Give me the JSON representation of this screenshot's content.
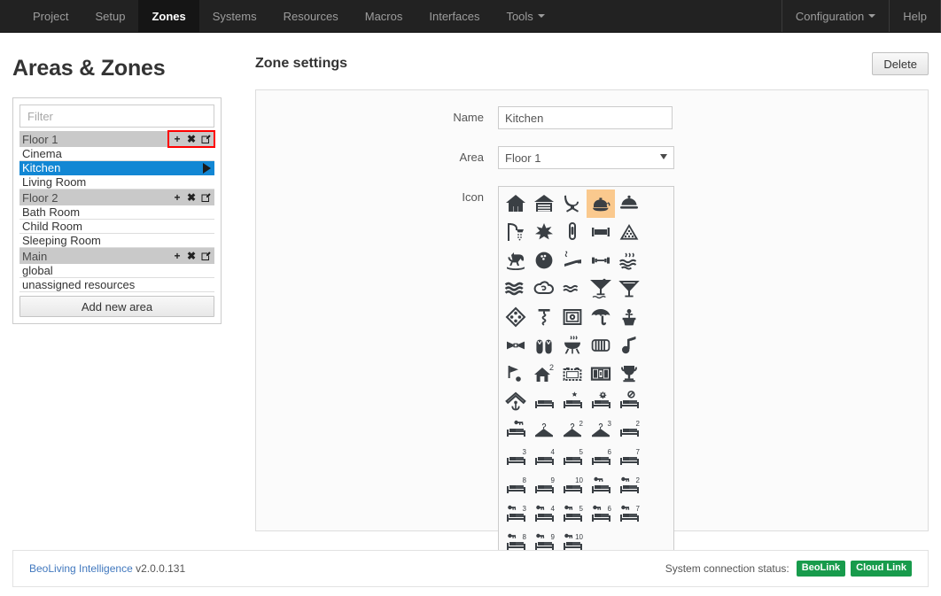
{
  "nav": {
    "left_items": [
      {
        "label": "Project",
        "active": false,
        "caret": false
      },
      {
        "label": "Setup",
        "active": false,
        "caret": false
      },
      {
        "label": "Zones",
        "active": true,
        "caret": false
      },
      {
        "label": "Systems",
        "active": false,
        "caret": false
      },
      {
        "label": "Resources",
        "active": false,
        "caret": false
      },
      {
        "label": "Macros",
        "active": false,
        "caret": false
      },
      {
        "label": "Interfaces",
        "active": false,
        "caret": false
      },
      {
        "label": "Tools",
        "active": false,
        "caret": true
      }
    ],
    "right_items": [
      {
        "label": "Configuration",
        "active": false,
        "caret": true
      },
      {
        "label": "Help",
        "active": false,
        "caret": false
      }
    ]
  },
  "sidebar": {
    "title": "Areas & Zones",
    "filter": {
      "value": "",
      "placeholder": "Filter"
    },
    "action_icons": {
      "add": "+",
      "remove": "✖",
      "edit": "edit-icon"
    },
    "groups": [
      {
        "label": "Floor 1",
        "actions_highlighted": true,
        "zones": [
          {
            "label": "Cinema",
            "selected": false
          },
          {
            "label": "Kitchen",
            "selected": true
          },
          {
            "label": "Living Room",
            "selected": false
          }
        ]
      },
      {
        "label": "Floor 2",
        "actions_highlighted": false,
        "zones": [
          {
            "label": "Bath Room",
            "selected": false
          },
          {
            "label": "Child Room",
            "selected": false
          },
          {
            "label": "Sleeping Room",
            "selected": false
          }
        ]
      },
      {
        "label": "Main",
        "actions_highlighted": false,
        "zones": [
          {
            "label": "global",
            "selected": false
          },
          {
            "label": "unassigned resources",
            "selected": false
          }
        ]
      }
    ],
    "add_area_label": "Add new area"
  },
  "main": {
    "section_title": "Zone settings",
    "delete_label": "Delete",
    "fields": {
      "name_label": "Name",
      "name_value": "Kitchen",
      "name_placeholder": "",
      "area_label": "Area",
      "area_value": "Floor 1",
      "area_options": [
        "Floor 1",
        "Floor 2",
        "Main"
      ],
      "icon_label": "Icon"
    },
    "icons": [
      {
        "name": "house-icon",
        "selected": false
      },
      {
        "name": "garage-icon",
        "selected": false
      },
      {
        "name": "lounge-chair-icon",
        "selected": false
      },
      {
        "name": "teapot-icon",
        "selected": true
      },
      {
        "name": "food-cloche-icon",
        "selected": false
      },
      {
        "name": "shower-icon",
        "selected": false
      },
      {
        "name": "leaf-star-icon",
        "selected": false
      },
      {
        "name": "paperclip-icon",
        "selected": false
      },
      {
        "name": "framed-picture-icon",
        "selected": false
      },
      {
        "name": "billiards-rack-icon",
        "selected": false
      },
      {
        "name": "rocking-horse-icon",
        "selected": false
      },
      {
        "name": "bowling-ball-icon",
        "selected": false
      },
      {
        "name": "cigar-smoke-icon",
        "selected": false
      },
      {
        "name": "dumbbell-icon",
        "selected": false
      },
      {
        "name": "hot-spring-icon",
        "selected": false
      },
      {
        "name": "waves-icon",
        "selected": false
      },
      {
        "name": "steam-cloud-icon",
        "selected": false
      },
      {
        "name": "small-waves-icon",
        "selected": false
      },
      {
        "name": "cocktail-water-icon",
        "selected": false
      },
      {
        "name": "martini-icon",
        "selected": false
      },
      {
        "name": "dice-domino-icon",
        "selected": false
      },
      {
        "name": "corkscrew-icon",
        "selected": false
      },
      {
        "name": "safe-icon",
        "selected": false
      },
      {
        "name": "umbrella-icon",
        "selected": false
      },
      {
        "name": "potted-plant-icon",
        "selected": false
      },
      {
        "name": "bow-tie-icon",
        "selected": false
      },
      {
        "name": "flip-flops-icon",
        "selected": false
      },
      {
        "name": "bbq-grill-icon",
        "selected": false
      },
      {
        "name": "radiator-icon",
        "selected": false
      },
      {
        "name": "music-note-icon",
        "selected": false
      },
      {
        "name": "golf-flag-icon",
        "selected": false
      },
      {
        "name": "house-2-icon",
        "selected": false
      },
      {
        "name": "projector-screen-icon",
        "selected": false
      },
      {
        "name": "luggage-trunk-icon",
        "selected": false
      },
      {
        "name": "trophy-icon",
        "selected": false
      },
      {
        "name": "anchor-house-icon",
        "selected": false
      },
      {
        "name": "bed-icon",
        "selected": false
      },
      {
        "name": "bed-star-icon",
        "selected": false
      },
      {
        "name": "bed-gear-icon",
        "selected": false
      },
      {
        "name": "bed-no-smoking-icon",
        "selected": false
      },
      {
        "name": "bed-key-icon",
        "selected": false
      },
      {
        "name": "hanger-icon",
        "selected": false
      },
      {
        "name": "hanger-2-icon",
        "selected": false,
        "badge": "2"
      },
      {
        "name": "hanger-3-icon",
        "selected": false,
        "badge": "3"
      },
      {
        "name": "bed-2-icon",
        "selected": false,
        "badge": "2"
      },
      {
        "name": "bed-3-icon",
        "selected": false,
        "badge": "3"
      },
      {
        "name": "bed-4-icon",
        "selected": false,
        "badge": "4"
      },
      {
        "name": "bed-5-icon",
        "selected": false,
        "badge": "5"
      },
      {
        "name": "bed-6-icon",
        "selected": false,
        "badge": "6"
      },
      {
        "name": "bed-7-icon",
        "selected": false,
        "badge": "7"
      },
      {
        "name": "bed-8-icon",
        "selected": false,
        "badge": "8"
      },
      {
        "name": "bed-9-icon",
        "selected": false,
        "badge": "9"
      },
      {
        "name": "bed-10-icon",
        "selected": false,
        "badge": "10"
      },
      {
        "name": "bed-key-plain-icon",
        "selected": false
      },
      {
        "name": "bed-key-2-icon",
        "selected": false,
        "badge": "2"
      },
      {
        "name": "bed-key-3-icon",
        "selected": false,
        "badge": "3"
      },
      {
        "name": "bed-key-4-icon",
        "selected": false,
        "badge": "4"
      },
      {
        "name": "bed-key-5-icon",
        "selected": false,
        "badge": "5"
      },
      {
        "name": "bed-key-6-icon",
        "selected": false,
        "badge": "6"
      },
      {
        "name": "bed-key-7-icon",
        "selected": false,
        "badge": "7"
      },
      {
        "name": "bed-key-8-icon",
        "selected": false,
        "badge": "8"
      },
      {
        "name": "bed-key-9-icon",
        "selected": false,
        "badge": "9"
      },
      {
        "name": "bed-key-10-icon",
        "selected": false,
        "badge": "10"
      }
    ]
  },
  "footer": {
    "app_name": "BeoLiving Intelligence",
    "version": "v2.0.0.131",
    "status_label": "System connection status:",
    "badges": [
      {
        "label": "BeoLink",
        "color": "#189b4c"
      },
      {
        "label": "Cloud Link",
        "color": "#189b4c"
      }
    ]
  },
  "colors": {
    "nav_bg": "#222222",
    "nav_active_bg": "#151515",
    "selected_row": "#1287d4",
    "group_header": "#c9c9c9",
    "icon_selected": "#fac98e",
    "highlight_outline": "#ff0000",
    "status_green": "#189b4c",
    "link_blue": "#4178be"
  }
}
